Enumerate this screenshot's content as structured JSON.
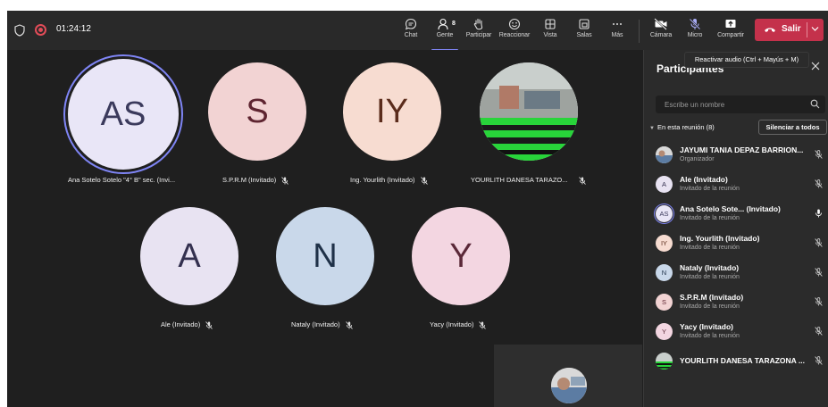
{
  "topbar": {
    "timer": "01:24:12",
    "people_count": "8",
    "buttons": [
      {
        "id": "chat",
        "label": "Chat",
        "icon": "chat-icon"
      },
      {
        "id": "people",
        "label": "Gente",
        "icon": "people-icon"
      },
      {
        "id": "raise",
        "label": "Participar",
        "icon": "hand-icon"
      },
      {
        "id": "react",
        "label": "Reaccionar",
        "icon": "smile-icon"
      },
      {
        "id": "view",
        "label": "Vista",
        "icon": "grid-icon"
      },
      {
        "id": "rooms",
        "label": "Salas",
        "icon": "rooms-icon"
      },
      {
        "id": "more",
        "label": "Más",
        "icon": "more-icon"
      },
      {
        "id": "camera",
        "label": "Cámara",
        "icon": "camera-off-icon"
      },
      {
        "id": "mic",
        "label": "Micro",
        "icon": "mic-off-icon"
      },
      {
        "id": "share",
        "label": "Compartir",
        "icon": "share-icon"
      }
    ],
    "leave_label": "Salir",
    "tooltip": "Reactivar audio (Ctrl + Mayús + M)"
  },
  "stage": {
    "tiles": [
      {
        "initials": "AS",
        "name": "Ana Sotelo Sotelo \"4° B\" sec. (Invi...",
        "bg": "#e9e6f7",
        "fg": "#3b3a5c",
        "muted": false,
        "speaking": true
      },
      {
        "initials": "S",
        "name": "S.P.R.M (Invitado)",
        "bg": "#f2d3d3",
        "fg": "#5e2430",
        "muted": true
      },
      {
        "initials": "IY",
        "name": "Ing. Yourlith (Invitado)",
        "bg": "#f7dcd1",
        "fg": "#5b2c1c",
        "muted": true
      },
      {
        "initials": "",
        "name": "YOURLITH DANESA TARAZO...",
        "photo": true,
        "muted": true
      },
      {
        "initials": "A",
        "name": "Ale (Invitado)",
        "bg": "#e8e3f2",
        "fg": "#33304f",
        "muted": true
      },
      {
        "initials": "N",
        "name": "Nataly (Invitado)",
        "bg": "#c9d8ea",
        "fg": "#1f3148",
        "muted": true
      },
      {
        "initials": "Y",
        "name": "Yacy (Invitado)",
        "bg": "#f3d6e1",
        "fg": "#5a2838",
        "muted": true
      }
    ]
  },
  "panel": {
    "title": "Participantes",
    "search_placeholder": "Escribe un nombre",
    "section_label": "En esta reunión (8)",
    "mute_all_label": "Silenciar a todos",
    "participants": [
      {
        "initials": "",
        "photo": true,
        "name": "JAYUMI TANIA DEPAZ BARRION...",
        "role": "Organizador",
        "muted": true
      },
      {
        "initials": "A",
        "name": "Ale (Invitado)",
        "role": "Invitado de la reunión",
        "bg": "#e8e3f2",
        "fg": "#33304f",
        "muted": true
      },
      {
        "initials": "AS",
        "name": "Ana Sotelo Sote... (Invitado)",
        "role": "Invitado de la reunión",
        "bg": "#e9e6f7",
        "fg": "#3b3a5c",
        "muted": false,
        "ring": true
      },
      {
        "initials": "IY",
        "name": "Ing. Yourlith (Invitado)",
        "role": "Invitado de la reunión",
        "bg": "#f7dcd1",
        "fg": "#5b2c1c",
        "muted": true
      },
      {
        "initials": "N",
        "name": "Nataly (Invitado)",
        "role": "Invitado de la reunión",
        "bg": "#c9d8ea",
        "fg": "#1f3148",
        "muted": true
      },
      {
        "initials": "S",
        "name": "S.P.R.M (Invitado)",
        "role": "Invitado de la reunión",
        "bg": "#f2d3d3",
        "fg": "#5e2430",
        "muted": true
      },
      {
        "initials": "Y",
        "name": "Yacy (Invitado)",
        "role": "Invitado de la reunión",
        "bg": "#f3d6e1",
        "fg": "#5a2838",
        "muted": true
      },
      {
        "initials": "",
        "photo": true,
        "stripes": true,
        "name": "YOURLITH DANESA TARAZONA ...",
        "role": "",
        "muted": true
      }
    ]
  },
  "colors": {
    "accent": "#7f85f5",
    "leave": "#c4314b",
    "background": "#1f1f1f",
    "panel": "#2b2b2b"
  }
}
